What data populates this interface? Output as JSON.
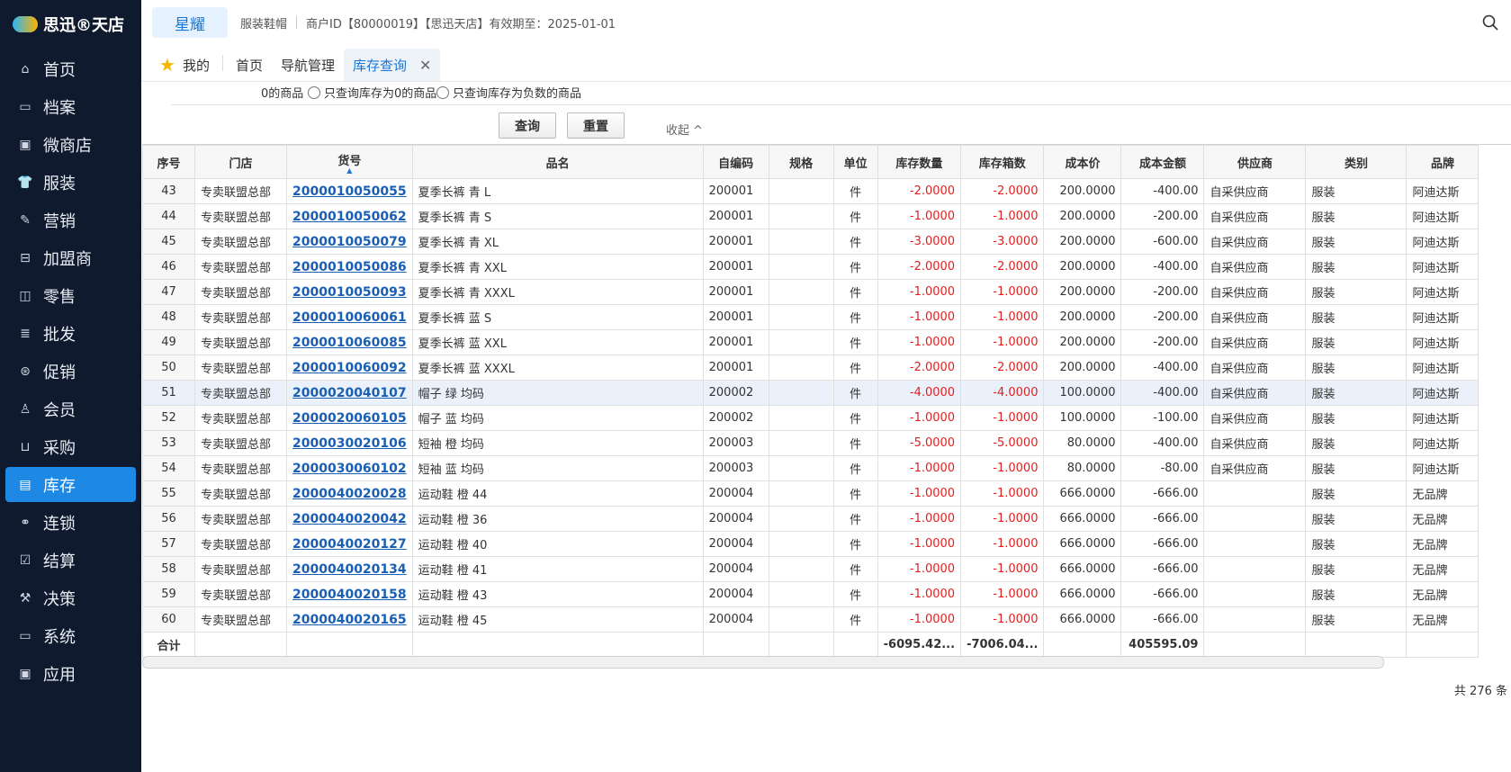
{
  "sidebar": {
    "logo": "思迅®天店",
    "items": [
      {
        "label": "首页",
        "icon": "home-icon",
        "glyph": "⌂"
      },
      {
        "label": "档案",
        "icon": "folder-icon",
        "glyph": "▭"
      },
      {
        "label": "微商店",
        "icon": "store-icon",
        "glyph": "▣"
      },
      {
        "label": "服装",
        "icon": "shirt-icon",
        "glyph": "👕"
      },
      {
        "label": "营销",
        "icon": "megaphone-icon",
        "glyph": "✎"
      },
      {
        "label": "加盟商",
        "icon": "partner-icon",
        "glyph": "⊟"
      },
      {
        "label": "零售",
        "icon": "bag-icon",
        "glyph": "◫"
      },
      {
        "label": "批发",
        "icon": "box-icon",
        "glyph": "≣"
      },
      {
        "label": "促销",
        "icon": "gift-icon",
        "glyph": "⊛"
      },
      {
        "label": "会员",
        "icon": "user-icon",
        "glyph": "♙"
      },
      {
        "label": "采购",
        "icon": "cart-icon",
        "glyph": "⊔"
      },
      {
        "label": "库存",
        "icon": "inventory-icon",
        "glyph": "▤",
        "active": true
      },
      {
        "label": "连锁",
        "icon": "link-icon",
        "glyph": "⚭"
      },
      {
        "label": "结算",
        "icon": "settlement-icon",
        "glyph": "☑"
      },
      {
        "label": "决策",
        "icon": "decision-icon",
        "glyph": "⚒"
      },
      {
        "label": "系统",
        "icon": "monitor-icon",
        "glyph": "▭"
      },
      {
        "label": "应用",
        "icon": "app-icon",
        "glyph": "▣"
      }
    ]
  },
  "header": {
    "brand": "星耀",
    "industry": "服装鞋帽",
    "merchant": "商户ID【80000019】【思迅天店】有效期至：2025-01-01"
  },
  "tabs": {
    "mine": "我的",
    "home": "首页",
    "nav": "导航管理",
    "current": "库存查询",
    "close": "✕"
  },
  "filters": {
    "prefix": "0的商品",
    "opt_zero": "只查询库存为0的商品",
    "opt_negative": "只查询库存为负数的商品",
    "query_btn": "查询",
    "reset_btn": "重置",
    "collapse": "收起 ^"
  },
  "table": {
    "headers": [
      "序号",
      "门店",
      "货号",
      "品名",
      "自编码",
      "规格",
      "单位",
      "库存数量",
      "库存箱数",
      "成本价",
      "成本金额",
      "供应商",
      "类别",
      "品牌"
    ],
    "rows": [
      [
        "43",
        "专卖联盟总部",
        "2000010050055",
        "夏季长裤 青 L",
        "200001",
        "",
        "件",
        "-2.0000",
        "-2.0000",
        "200.0000",
        "-400.00",
        "自采供应商",
        "服装",
        "阿迪达斯"
      ],
      [
        "44",
        "专卖联盟总部",
        "2000010050062",
        "夏季长裤 青 S",
        "200001",
        "",
        "件",
        "-1.0000",
        "-1.0000",
        "200.0000",
        "-200.00",
        "自采供应商",
        "服装",
        "阿迪达斯"
      ],
      [
        "45",
        "专卖联盟总部",
        "2000010050079",
        "夏季长裤 青 XL",
        "200001",
        "",
        "件",
        "-3.0000",
        "-3.0000",
        "200.0000",
        "-600.00",
        "自采供应商",
        "服装",
        "阿迪达斯"
      ],
      [
        "46",
        "专卖联盟总部",
        "2000010050086",
        "夏季长裤 青 XXL",
        "200001",
        "",
        "件",
        "-2.0000",
        "-2.0000",
        "200.0000",
        "-400.00",
        "自采供应商",
        "服装",
        "阿迪达斯"
      ],
      [
        "47",
        "专卖联盟总部",
        "2000010050093",
        "夏季长裤 青 XXXL",
        "200001",
        "",
        "件",
        "-1.0000",
        "-1.0000",
        "200.0000",
        "-200.00",
        "自采供应商",
        "服装",
        "阿迪达斯"
      ],
      [
        "48",
        "专卖联盟总部",
        "2000010060061",
        "夏季长裤 蓝 S",
        "200001",
        "",
        "件",
        "-1.0000",
        "-1.0000",
        "200.0000",
        "-200.00",
        "自采供应商",
        "服装",
        "阿迪达斯"
      ],
      [
        "49",
        "专卖联盟总部",
        "2000010060085",
        "夏季长裤 蓝 XXL",
        "200001",
        "",
        "件",
        "-1.0000",
        "-1.0000",
        "200.0000",
        "-200.00",
        "自采供应商",
        "服装",
        "阿迪达斯"
      ],
      [
        "50",
        "专卖联盟总部",
        "2000010060092",
        "夏季长裤 蓝 XXXL",
        "200001",
        "",
        "件",
        "-2.0000",
        "-2.0000",
        "200.0000",
        "-400.00",
        "自采供应商",
        "服装",
        "阿迪达斯"
      ],
      [
        "51",
        "专卖联盟总部",
        "2000020040107",
        "帽子 绿 均码",
        "200002",
        "",
        "件",
        "-4.0000",
        "-4.0000",
        "100.0000",
        "-400.00",
        "自采供应商",
        "服装",
        "阿迪达斯"
      ],
      [
        "52",
        "专卖联盟总部",
        "2000020060105",
        "帽子 蓝 均码",
        "200002",
        "",
        "件",
        "-1.0000",
        "-1.0000",
        "100.0000",
        "-100.00",
        "自采供应商",
        "服装",
        "阿迪达斯"
      ],
      [
        "53",
        "专卖联盟总部",
        "2000030020106",
        "短袖 橙 均码",
        "200003",
        "",
        "件",
        "-5.0000",
        "-5.0000",
        "80.0000",
        "-400.00",
        "自采供应商",
        "服装",
        "阿迪达斯"
      ],
      [
        "54",
        "专卖联盟总部",
        "2000030060102",
        "短袖 蓝 均码",
        "200003",
        "",
        "件",
        "-1.0000",
        "-1.0000",
        "80.0000",
        "-80.00",
        "自采供应商",
        "服装",
        "阿迪达斯"
      ],
      [
        "55",
        "专卖联盟总部",
        "2000040020028",
        "运动鞋 橙 44",
        "200004",
        "",
        "件",
        "-1.0000",
        "-1.0000",
        "666.0000",
        "-666.00",
        "",
        "服装",
        "无品牌"
      ],
      [
        "56",
        "专卖联盟总部",
        "2000040020042",
        "运动鞋 橙 36",
        "200004",
        "",
        "件",
        "-1.0000",
        "-1.0000",
        "666.0000",
        "-666.00",
        "",
        "服装",
        "无品牌"
      ],
      [
        "57",
        "专卖联盟总部",
        "2000040020127",
        "运动鞋 橙 40",
        "200004",
        "",
        "件",
        "-1.0000",
        "-1.0000",
        "666.0000",
        "-666.00",
        "",
        "服装",
        "无品牌"
      ],
      [
        "58",
        "专卖联盟总部",
        "2000040020134",
        "运动鞋 橙 41",
        "200004",
        "",
        "件",
        "-1.0000",
        "-1.0000",
        "666.0000",
        "-666.00",
        "",
        "服装",
        "无品牌"
      ],
      [
        "59",
        "专卖联盟总部",
        "2000040020158",
        "运动鞋 橙 43",
        "200004",
        "",
        "件",
        "-1.0000",
        "-1.0000",
        "666.0000",
        "-666.00",
        "",
        "服装",
        "无品牌"
      ],
      [
        "60",
        "专卖联盟总部",
        "2000040020165",
        "运动鞋 橙 45",
        "200004",
        "",
        "件",
        "-1.0000",
        "-1.0000",
        "666.0000",
        "-666.00",
        "",
        "服装",
        "无品牌"
      ]
    ],
    "highlight_row": "51",
    "totals": {
      "label": "合计",
      "qty": "-6095.42...",
      "boxes": "-7006.04...",
      "amount": "405595.09"
    }
  },
  "footer": {
    "count": "共 276 条"
  },
  "colors": {
    "sidebar_bg": "#0f1a2e",
    "accent": "#1e88e5",
    "link": "#1a5fb4",
    "negative": "#e02020"
  }
}
